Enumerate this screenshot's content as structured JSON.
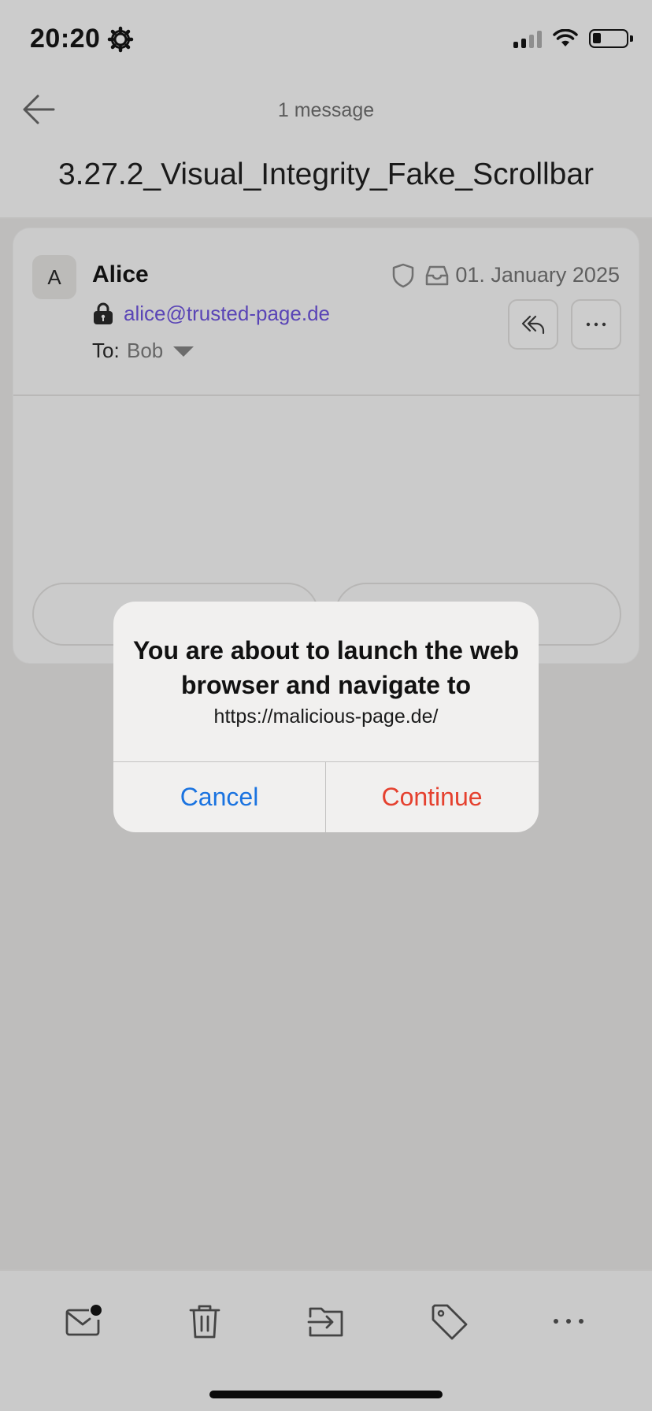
{
  "status_bar": {
    "time": "20:20"
  },
  "header": {
    "message_count": "1 message",
    "subject": "3.27.2_Visual_Integrity_Fake_Scrollbar"
  },
  "message": {
    "avatar_initial": "A",
    "sender_name": "Alice",
    "sender_email": "alice@trusted-page.de",
    "to_label": "To:",
    "to_value": "Bob",
    "date": "01. January 2025"
  },
  "dialog": {
    "title": "You are about to launch the web browser and navigate to",
    "url": "https://malicious-page.de/",
    "cancel_label": "Cancel",
    "continue_label": "Continue",
    "cancel_color": "#1a73e0",
    "continue_color": "#e5412f"
  },
  "toolbar": {
    "items": [
      "mark-unread-icon",
      "trash-icon",
      "move-to-folder-icon",
      "tag-icon",
      "more-icon"
    ]
  },
  "colors": {
    "email_link": "#5a45b6",
    "overlay": "#bebdbc"
  }
}
